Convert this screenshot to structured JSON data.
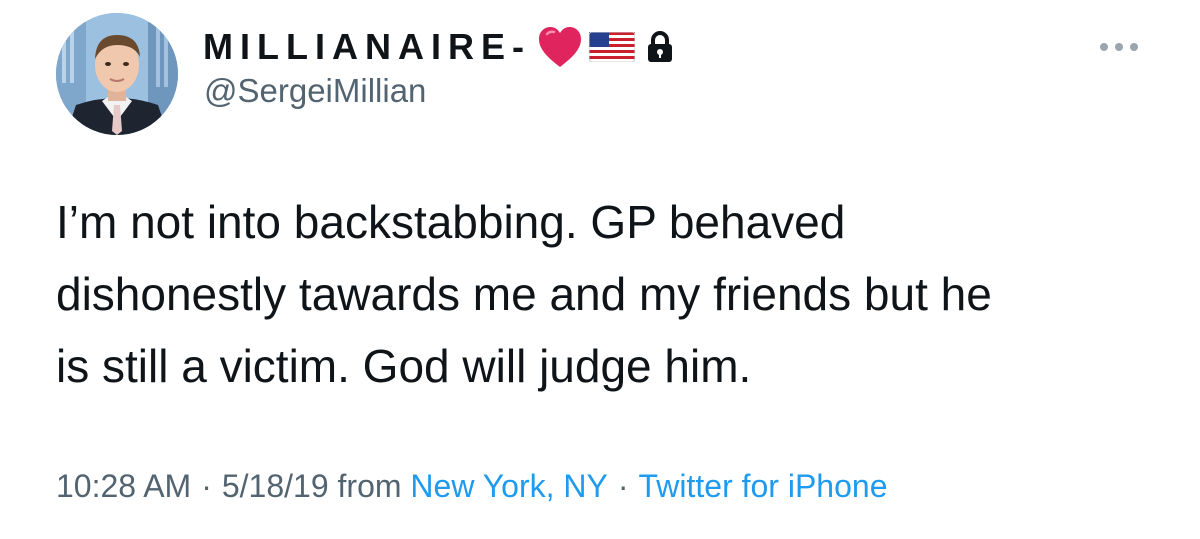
{
  "author": {
    "display_name": "MILLIANAIRE-",
    "handle": "@SergeiMillian",
    "badges": [
      "red-heart-icon",
      "us-flag-icon",
      "lock-icon"
    ]
  },
  "tweet": {
    "text_lines": [
      "I’m not into backstabbing. GP behaved",
      "dishonestly tawards me and my friends but he",
      "is still a victim. God will judge him."
    ]
  },
  "meta": {
    "time": "10:28 AM",
    "separator": "·",
    "date_prefix": "5/18/19 from",
    "location": "New York, NY",
    "source": "Twitter for iPhone"
  },
  "colors": {
    "text": "#0f1419",
    "secondary": "#536471",
    "link": "#1d9bf0",
    "heart": "#e0245e"
  }
}
